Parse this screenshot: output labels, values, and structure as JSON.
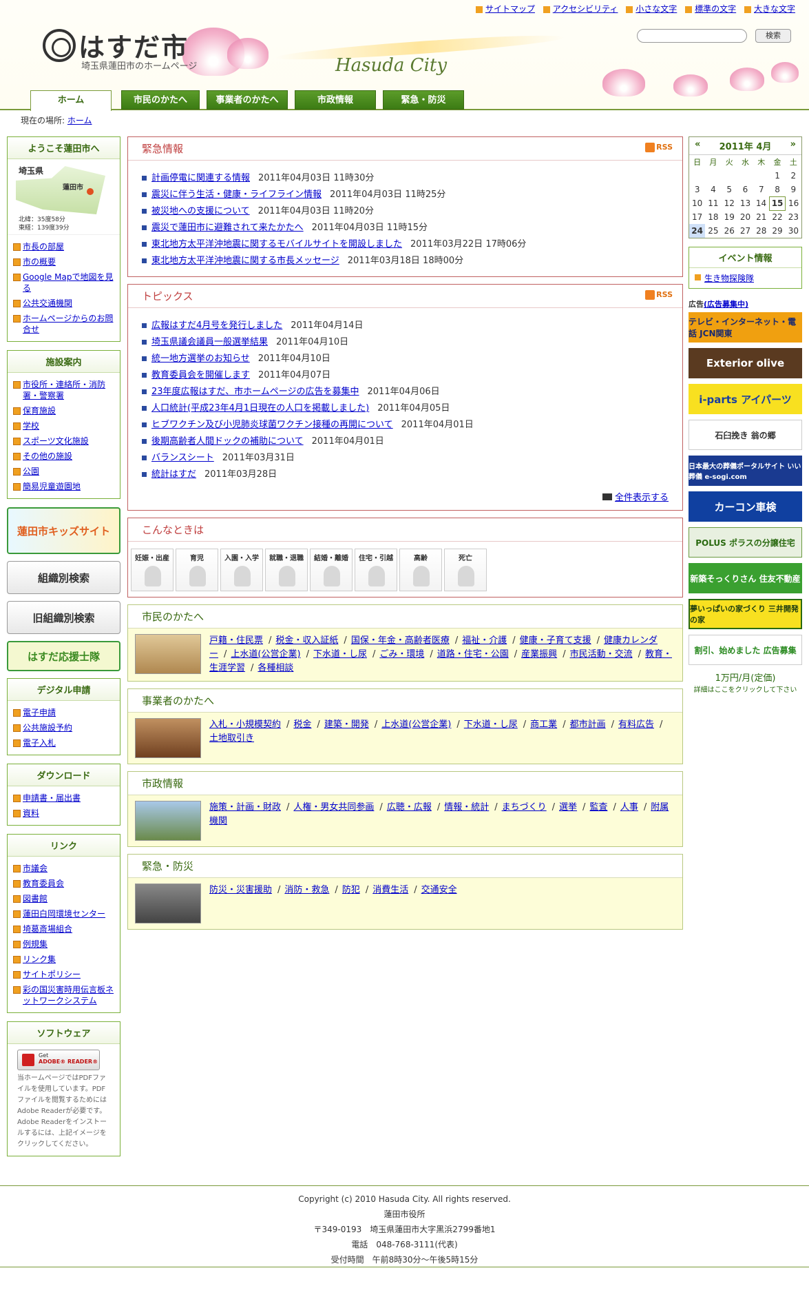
{
  "util_links": [
    "サイトマップ",
    "アクセシビリティ",
    "小さな文字",
    "標準の文字",
    "大きな文字"
  ],
  "site": {
    "name": "はすだ市",
    "sub": "埼玉県蓮田市のホームページ",
    "en": "Hasuda City"
  },
  "search": {
    "placeholder": "",
    "button": "検索"
  },
  "nav": [
    "ホーム",
    "市民のかたへ",
    "事業者のかたへ",
    "市政情報",
    "緊急・防災"
  ],
  "breadcrumb": {
    "label": "現在の場所:",
    "current": "ホーム"
  },
  "welcome": {
    "title": "ようこそ蓮田市へ",
    "map_pref": "埼玉県",
    "map_city": "蓮田市",
    "lat": "北緯：35度58分",
    "lon": "東経：139度39分",
    "items": [
      "市長の部屋",
      "市の概要",
      "Google Mapで地図を見る",
      "公共交通機関",
      "ホームページからのお問合せ"
    ]
  },
  "facilities": {
    "title": "施設案内",
    "items": [
      "市役所・連絡所・消防署・警察署",
      "保育施設",
      "学校",
      "スポーツ文化施設",
      "その他の施設",
      "公園",
      "簡易児童遊園地"
    ]
  },
  "banners": [
    "蓮田市キッズサイト",
    "組織別検索",
    "旧組織別検索",
    "はすだ応援士隊"
  ],
  "digital": {
    "title": "デジタル申請",
    "items": [
      "電子申請",
      "公共施設予約",
      "電子入札"
    ]
  },
  "download": {
    "title": "ダウンロード",
    "items": [
      "申請書・届出書",
      "資料"
    ]
  },
  "links": {
    "title": "リンク",
    "items": [
      "市議会",
      "教育委員会",
      "図書館",
      "蓮田白岡環境センター",
      "埼葛斎場組合",
      "例規集",
      "リンク集",
      "サイトポリシー",
      "彩の国災害時用伝言板ネットワークシステム"
    ]
  },
  "software": {
    "title": "ソフトウェア",
    "badge_top": "Get",
    "badge": "ADOBE® READER®",
    "text": "当ホームページではPDFファイルを使用しています。PDFファイルを閲覧するためにはAdobe Readerが必要です。Adobe Readerをインストールするには、上記イメージをクリックしてください。"
  },
  "emergency": {
    "title": "緊急情報",
    "rss": "RSS",
    "items": [
      {
        "t": "計画停電に関連する情報",
        "d": "2011年04月03日 11時30分"
      },
      {
        "t": "震災に伴う生活・健康・ライフライン情報",
        "d": "2011年04月03日 11時25分"
      },
      {
        "t": "被災地への支援について",
        "d": "2011年04月03日 11時20分"
      },
      {
        "t": "震災で蓮田市に避難されて来たかたへ",
        "d": "2011年04月03日 11時15分"
      },
      {
        "t": "東北地方太平洋沖地震に関するモバイルサイトを開設しました",
        "d": "2011年03月22日 17時06分"
      },
      {
        "t": "東北地方太平洋沖地震に関する市長メッセージ",
        "d": "2011年03月18日 18時00分"
      }
    ]
  },
  "topics": {
    "title": "トピックス",
    "rss": "RSS",
    "more": "全件表示する",
    "items": [
      {
        "t": "広報はすだ4月号を発行しました",
        "d": "2011年04月14日"
      },
      {
        "t": "埼玉県議会議員一般選挙結果",
        "d": "2011年04月10日"
      },
      {
        "t": "統一地方選挙のお知らせ",
        "d": "2011年04月10日"
      },
      {
        "t": "教育委員会を開催します",
        "d": "2011年04月07日"
      },
      {
        "t": "23年度広報はすだ、市ホームページの広告を募集中",
        "d": "2011年04月06日"
      },
      {
        "t": "人口統計(平成23年4月1日現在の人口を掲載しました)",
        "d": "2011年04月05日"
      },
      {
        "t": "ヒブワクチン及び小児肺炎球菌ワクチン接種の再開について",
        "d": "2011年04月01日"
      },
      {
        "t": "後期高齢者人間ドックの補助について",
        "d": "2011年04月01日"
      },
      {
        "t": "バランスシート",
        "d": "2011年03月31日"
      },
      {
        "t": "統計はすだ",
        "d": "2011年03月28日"
      }
    ]
  },
  "konna": {
    "title": "こんなときは",
    "items": [
      "妊娠・出産",
      "育児",
      "入園・入学",
      "就職・退職",
      "結婚・離婚",
      "住宅・引越",
      "高齢",
      "死亡"
    ]
  },
  "citizens": {
    "title": "市民のかたへ",
    "links": [
      "戸籍・住民票",
      "税金・収入証紙",
      "国保・年金・高齢者医療",
      "福祉・介護",
      "健康・子育て支援",
      "健康カレンダー",
      "上水道(公営企業)",
      "下水道・し尿",
      "ごみ・環境",
      "道路・住宅・公園",
      "産業振興",
      "市民活動・交流",
      "教育・生涯学習",
      "各種相談"
    ]
  },
  "business": {
    "title": "事業者のかたへ",
    "links": [
      "入札・小規模契約",
      "税金",
      "建築・開発",
      "上水道(公営企業)",
      "下水道・し尿",
      "商工業",
      "都市計画",
      "有料広告",
      "土地取引き"
    ]
  },
  "municipal": {
    "title": "市政情報",
    "links": [
      "施策・計画・財政",
      "人権・男女共同参画",
      "広聴・広報",
      "情報・統計",
      "まちづくり",
      "選挙",
      "監査",
      "人事",
      "附属機関"
    ]
  },
  "disaster": {
    "title": "緊急・防災",
    "links": [
      "防災・災害援助",
      "消防・救急",
      "防犯",
      "消費生活",
      "交通安全"
    ]
  },
  "calendar": {
    "prev": "«",
    "next": "»",
    "title": "2011年 4月",
    "dow": [
      "日",
      "月",
      "火",
      "水",
      "木",
      "金",
      "土"
    ],
    "rows": [
      [
        "",
        "",
        "",
        "",
        "",
        "1",
        "2"
      ],
      [
        "3",
        "4",
        "5",
        "6",
        "7",
        "8",
        "9"
      ],
      [
        "10",
        "11",
        "12",
        "13",
        "14",
        "15",
        "16"
      ],
      [
        "17",
        "18",
        "19",
        "20",
        "21",
        "22",
        "23"
      ],
      [
        "24",
        "25",
        "26",
        "27",
        "28",
        "29",
        "30"
      ]
    ]
  },
  "event": {
    "title": "イベント情報",
    "items": [
      "生き物探険隊"
    ]
  },
  "ads": {
    "label": "広告",
    "link": "(広告募集中)",
    "items": [
      "テレビ・インターネット・電話 JCN関東",
      "Exterior olive",
      "i-parts アイパーツ",
      "石臼挽き 翁の郷",
      "日本最大の葬儀ポータルサイト いい葬儀 e-sogi.com",
      "カーコン車検",
      "POLUS ポラスの分譲住宅",
      "新築そっくりさん 住友不動産",
      "夢いっぱいの家づくり 三井開発の家",
      "割引、始めました 広告募集",
      "1万円/月(定価)",
      "詳細はここをクリックして下さい"
    ]
  },
  "footer": [
    "Copyright (c) 2010 Hasuda City. All rights reserved.",
    "蓮田市役所",
    "〒349-0193　埼玉県蓮田市大字黒浜2799番地1",
    "電話　048-768-3111(代表)",
    "受付時間　午前8時30分～午後5時15分"
  ],
  "colors": {
    "accent": "#3a6a12",
    "emergency": "#c04040",
    "bullet": "#f0a020"
  }
}
